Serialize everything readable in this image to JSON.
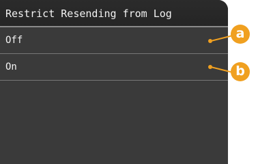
{
  "screen": {
    "title": "Restrict Resending from Log",
    "items": [
      {
        "label": "Off"
      },
      {
        "label": "On"
      }
    ]
  },
  "callouts": [
    {
      "letter": "a"
    },
    {
      "letter": "b"
    }
  ],
  "colors": {
    "screen_background": "#3a3a3a",
    "title_background": "#2b2b2b",
    "text": "#f4f4f4",
    "callout": "#f0a020"
  }
}
